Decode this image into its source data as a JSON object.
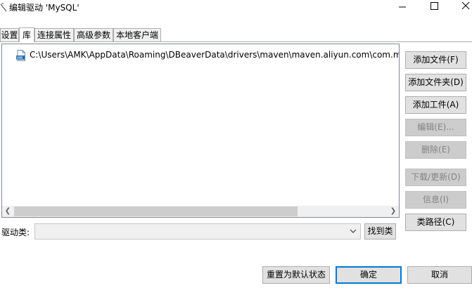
{
  "window": {
    "title": "编辑驱动 'MySQL'",
    "icon": "app-icon",
    "controls": [
      "minimize-icon",
      "maximize-icon",
      "close-icon"
    ]
  },
  "tabs": [
    {
      "label": "设置",
      "active": false
    },
    {
      "label": "库",
      "active": true
    },
    {
      "label": "连接属性",
      "active": false
    },
    {
      "label": "高级参数",
      "active": false
    },
    {
      "label": "本地客户端",
      "active": false
    }
  ],
  "library": {
    "items": [
      {
        "icon": "jar-file-icon",
        "path": "C:\\Users\\AMK\\AppData\\Roaming\\DBeaverData\\drivers\\maven\\maven.aliyun.com\\com.my"
      }
    ]
  },
  "side_buttons": {
    "add_file": "添加文件(F)",
    "add_folder": "添加文件夹(D)",
    "add_artifact": "添加工件(A)",
    "edit": "编辑(E)...",
    "delete": "删除(E)",
    "download_update": "下载/更新(D)",
    "info": "信息(I)",
    "class_path": "类路径(C)"
  },
  "driver_class": {
    "label": "驱动类:",
    "value": "",
    "find_button": "找到类"
  },
  "footer": {
    "reset": "重置为默认状态",
    "ok": "确定",
    "cancel": "取消"
  },
  "colors": {
    "default_button_border": "#0078d7",
    "disabled_text": "#838383",
    "button_face": "#e1e1e1"
  }
}
